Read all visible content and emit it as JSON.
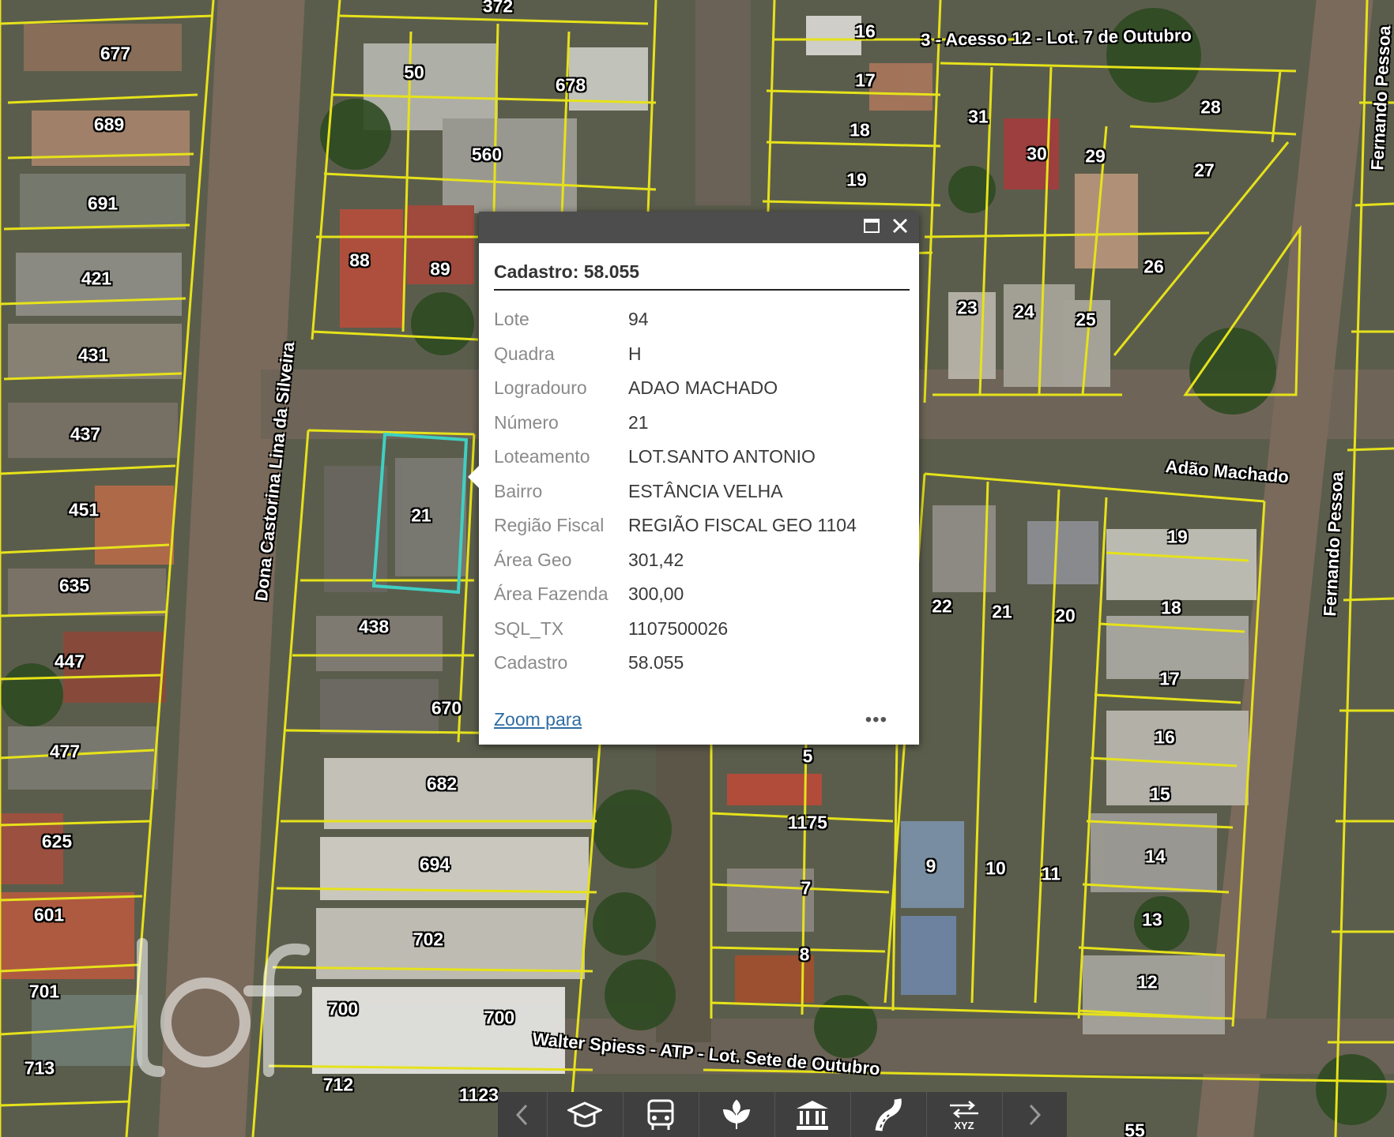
{
  "popup": {
    "title": "Cadastro: 58.055",
    "attributes": [
      {
        "key": "Lote",
        "value": "94"
      },
      {
        "key": "Quadra",
        "value": "H"
      },
      {
        "key": "Logradouro",
        "value": "ADAO MACHADO"
      },
      {
        "key": "Número",
        "value": "21"
      },
      {
        "key": "Loteamento",
        "value": "LOT.SANTO ANTONIO"
      },
      {
        "key": "Bairro",
        "value": "ESTÂNCIA VELHA"
      },
      {
        "key": "Região Fiscal",
        "value": "REGIÃO FISCAL GEO 1104"
      },
      {
        "key": "Área Geo",
        "value": "301,42"
      },
      {
        "key": "Área Fazenda",
        "value": "300,00"
      },
      {
        "key": "SQL_TX",
        "value": "1107500026"
      },
      {
        "key": "Cadastro",
        "value": "58.055"
      }
    ],
    "zoom_link": "Zoom para",
    "more_label": "•••",
    "maximize_icon": "maximize-icon",
    "close_icon": "close-icon"
  },
  "streets": [
    "Dona Castorina Lina da Silveira",
    "Adão Machado",
    "Fernando Pessoa",
    "Fernando Pessoa",
    "3 - Acesso 12 - Lot. 7 de Outubro",
    "Walter Spiess - ATP - Lot. Sete de Outubro"
  ],
  "parcel_labels": [
    "372",
    "677",
    "689",
    "691",
    "421",
    "431",
    "437",
    "451",
    "635",
    "447",
    "477",
    "625",
    "601",
    "701",
    "713",
    "50",
    "678",
    "560",
    "88",
    "89",
    "21",
    "438",
    "670",
    "682",
    "694",
    "702",
    "700",
    "700",
    "712",
    "1123",
    "16",
    "17",
    "18",
    "19",
    "31",
    "30",
    "29",
    "28",
    "27",
    "26",
    "23",
    "24",
    "25",
    "22",
    "21",
    "20",
    "19",
    "18",
    "17",
    "16",
    "15",
    "14",
    "13",
    "12",
    "11",
    "10",
    "9",
    "5",
    "1175",
    "7",
    "8",
    "55"
  ],
  "toolbar": {
    "prev_icon": "chevron-left-icon",
    "next_icon": "chevron-right-icon",
    "buttons": [
      "graduation-cap-icon",
      "bus-icon",
      "leaf-icon",
      "museum-icon",
      "road-icon",
      "xyz-icon"
    ],
    "xyz_label": "XYZ"
  },
  "colors": {
    "parcel_line": "#e6e21a",
    "selected_parcel": "#3fd0c2",
    "popup_header": "#4d4d4d"
  }
}
